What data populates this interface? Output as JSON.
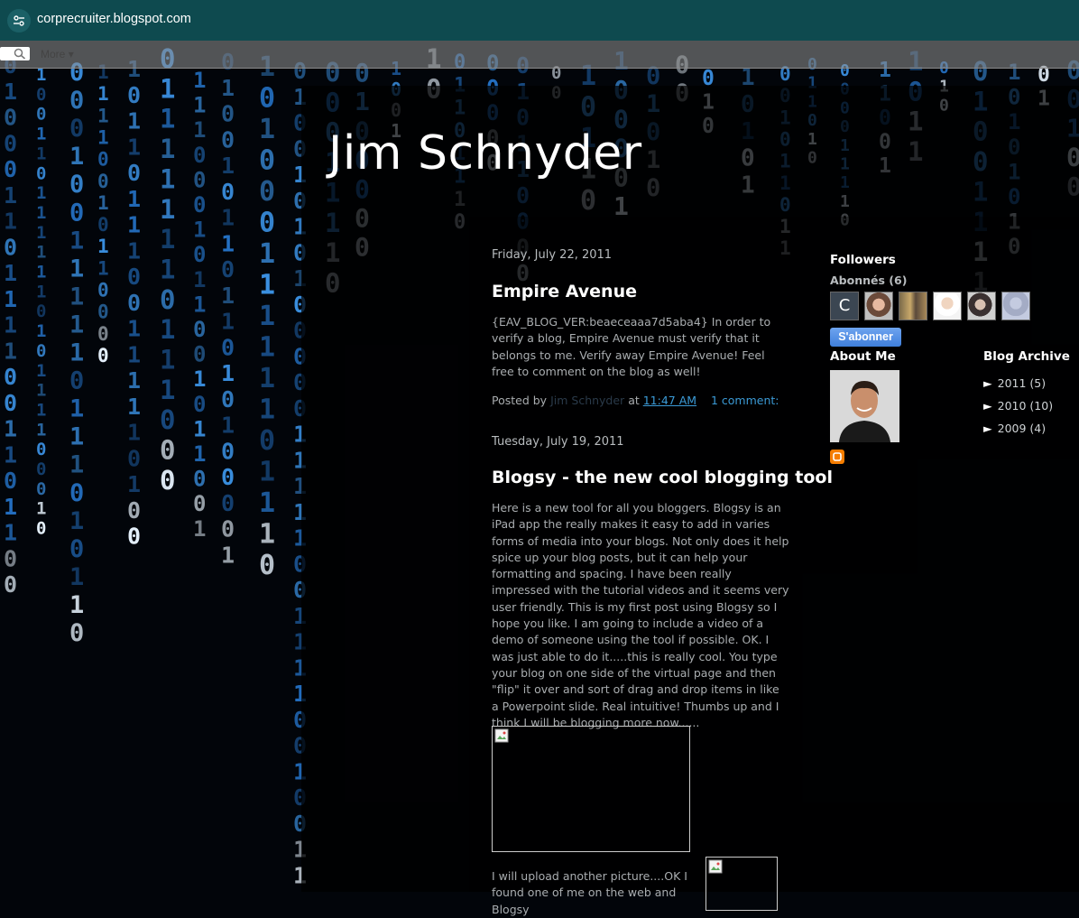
{
  "browser": {
    "url": "corprecruiter.blogspot.com"
  },
  "navbar": {
    "more_label": "More"
  },
  "blog": {
    "title": "Jim Schnyder"
  },
  "posts": [
    {
      "date": "Friday, July 22, 2011",
      "title": "Empire Avenue",
      "body": "{EAV_BLOG_VER:beaeceaaa7d5aba4} In order to verify a blog, Empire Avenue must verify that it belongs to me. Verify away Empire Avenue! Feel free to comment on the blog as well!",
      "posted_by_label": "Posted by",
      "author": "Jim Schnyder",
      "at_label": "at",
      "time": "11:47 AM",
      "comments": "1 comment:"
    },
    {
      "date": "Tuesday, July 19, 2011",
      "title": "Blogsy - the new cool blogging tool",
      "body": "Here is a new tool for all you bloggers. Blogsy is an iPad app the really makes it easy to add in varies forms of media into your blogs. Not only does it help spice up your blog posts, but it can help your formatting and spacing. I have been really impressed with the tutorial videos and it seems very user friendly. This is my first post using Blogsy so I hope you like. I am going to include a video of a demo of someone using the tool if possible. OK. I was just able to do it.....this is really cool. You type your blog on one side of the virtual page and then \"flip\" it over and sort of drag and drop items in like a Powerpoint slide. Real intuitive! Thumbs up and I think I will be blogging more now......",
      "body2": "I will upload another picture....OK I found one of me on the web and Blogsy"
    }
  ],
  "sidebar": {
    "followers_heading": "Followers",
    "followers_count": "Abonnés (6)",
    "first_follower_initial": "C",
    "subscribe_label": "S'abonner",
    "about_heading": "About Me",
    "archive_heading": "Blog Archive",
    "archive": [
      {
        "arrow": "►",
        "label": "2011 (5)"
      },
      {
        "arrow": "►",
        "label": "2010 (10)"
      },
      {
        "arrow": "►",
        "label": "2009 (4)"
      }
    ]
  },
  "colors": {
    "url_bar": "#0e4a4f",
    "link": "#3b9ad6",
    "matrix_blue": "#3a8fe0",
    "subscribe": "#4f8ee6"
  }
}
